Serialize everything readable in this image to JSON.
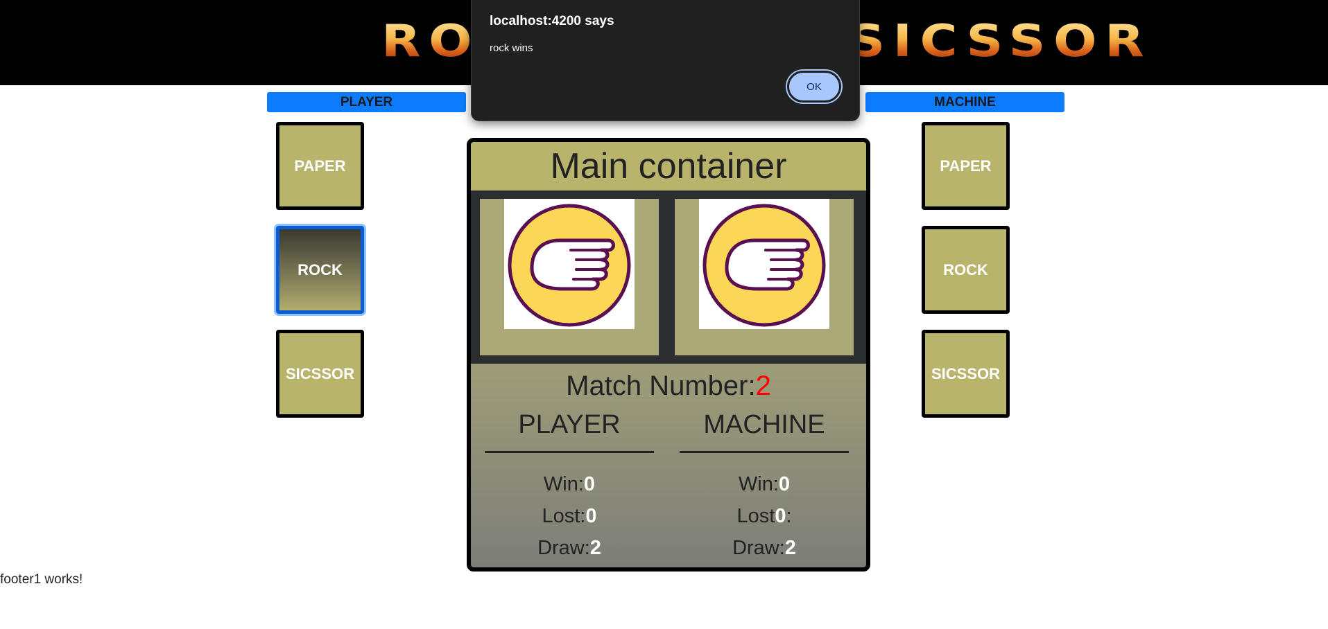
{
  "header": {
    "logo_text": "ROCK PAPER SICSSOR"
  },
  "player_panel": {
    "title": "PLAYER",
    "choices": [
      "PAPER",
      "ROCK",
      "SICSSOR"
    ],
    "selected": "ROCK"
  },
  "machine_panel": {
    "title": "MACHINE",
    "choices": [
      "PAPER",
      "ROCK",
      "SICSSOR"
    ]
  },
  "main": {
    "title": "Main container",
    "player_hand_icon": "rock-hand-icon",
    "machine_hand_icon": "rock-hand-icon",
    "match_label": "Match Number:",
    "match_number": "2",
    "player": {
      "heading": "PLAYER",
      "win_label": "Win:",
      "win": "0",
      "lost_label": "Lost:",
      "lost": "0",
      "draw_label": "Draw:",
      "draw": "2"
    },
    "machine": {
      "heading": "MACHINE",
      "win_label": "Win:",
      "win": "0",
      "lost_label": "Lost",
      "lost": "0",
      "lost_suffix": ":",
      "draw_label": "Draw:",
      "draw": "2"
    }
  },
  "footer": {
    "text": "footer1 works!"
  },
  "dialog": {
    "title": "localhost:4200 says",
    "message": "rock wins",
    "ok_label": "OK"
  },
  "colors": {
    "accent_blue": "#0d7bfd",
    "tile": "#b9b46c",
    "match_number": "#ff0000",
    "hand_fill": "#fcd757",
    "hand_stroke": "#5a1050"
  }
}
